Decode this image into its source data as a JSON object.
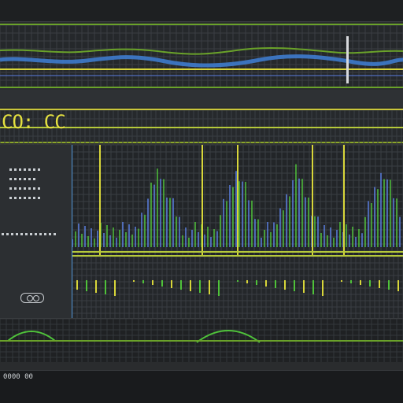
{
  "window": {
    "channel_label": "CO: CC",
    "status_text": "0000 00"
  },
  "icons": {
    "scope_button": "toggle-icon",
    "pin": "pin-icon"
  },
  "colors": {
    "background": "#2a2c2e",
    "grid": "#3d4146",
    "accent_green": "#6aa22a",
    "accent_yellow": "#d8d63a",
    "accent_blue": "#3f7fd6",
    "trace_green": "#4fc23a",
    "trace_blue": "#5a7ee0",
    "text": "#cfd3d6"
  }
}
